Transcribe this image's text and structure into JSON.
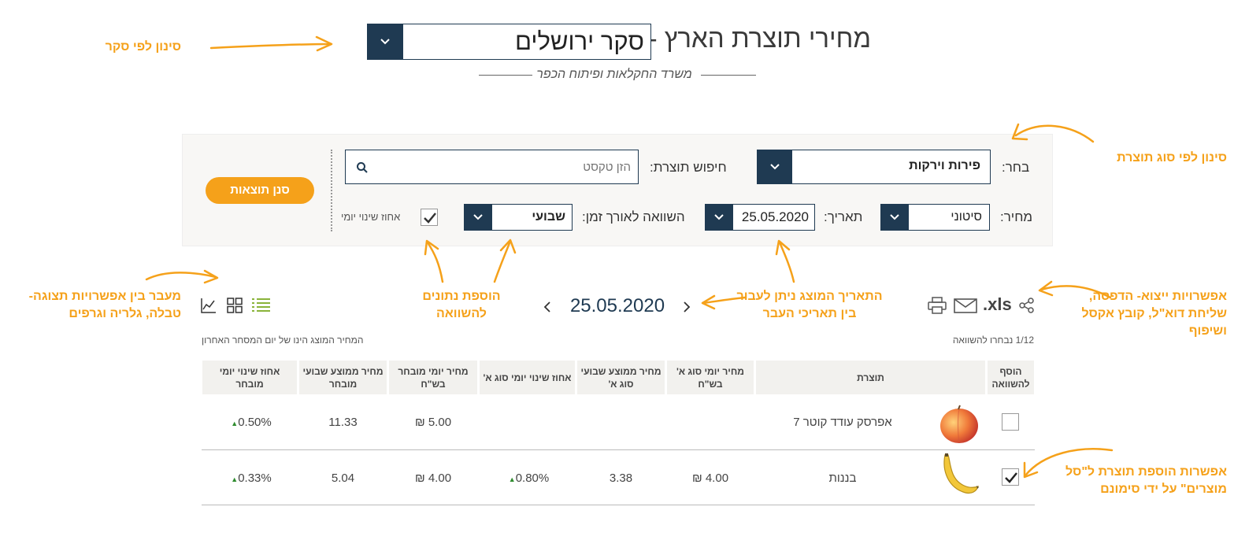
{
  "header": {
    "title": "מחירי תוצרת הארץ -",
    "survey_selected": "סקר ירושלים",
    "subtitle": "משרד החקלאות ופיתוח הכפר"
  },
  "filters": {
    "choose_label": "בחר:",
    "choose_value": "פירות וירקות",
    "search_label": "חיפוש תוצרת:",
    "search_placeholder": "הזן טקסט",
    "price_label": "מחיר:",
    "price_value": "סיטוני",
    "date_label": "תאריך:",
    "date_value": "25.05.2020",
    "compare_label": "השוואה לאורך זמן:",
    "compare_value": "שבועי",
    "daily_pct_label": "אחוז שינוי יומי",
    "daily_pct_checked": true,
    "filter_button": "סנן תוצאות"
  },
  "toolbar": {
    "xls_label": ".xls",
    "current_date": "25.05.2020",
    "selected_count": "1/12 נבחרו להשוואה",
    "price_note": "המחיר המוצג הינו של יום המסחר האחרון"
  },
  "table": {
    "headers": {
      "add": "הוסף להשוואה",
      "product": "תוצרת",
      "daily_a": "מחיר יומי סוג א' בש\"ח",
      "weekly_avg_a": "מחיר ממוצע שבועי סוג א'",
      "daily_pct_a": "אחוז שינוי יומי סוג א'",
      "daily_sel": "מחיר יומי מובחר בש\"ח",
      "weekly_avg_sel": "מחיר ממוצע שבועי מובחר",
      "daily_pct_sel": "אחוז שינוי יומי מובחר"
    },
    "rows": [
      {
        "checked": false,
        "image": "peach",
        "product": "אפרסק עודד קוטר 7",
        "daily_a": "",
        "weekly_avg_a": "",
        "daily_pct_a": "",
        "daily_sel": "5.00 ₪",
        "weekly_avg_sel": "11.33",
        "daily_pct_sel": "0.50%"
      },
      {
        "checked": true,
        "image": "banana",
        "product": "בננות",
        "daily_a": "4.00 ₪",
        "weekly_avg_a": "3.38",
        "daily_pct_a": "0.80%",
        "daily_sel": "4.00 ₪",
        "weekly_avg_sel": "5.04",
        "daily_pct_sel": "0.33%"
      }
    ]
  },
  "annotations": {
    "survey_filter": "סינון לפי סקר",
    "product_type_filter": "סינון לפי סוג תוצרת",
    "view_switch": "מעבר בין אפשרויות תצוגה- טבלה, גלריה וגרפים",
    "add_compare": "הוספת נתונים להשוואה",
    "date_nav": "התאריך המוצג ניתן לעבור בין תאריכי העבר",
    "export": "אפשרויות ייצוא- הדפסה, שליחת דוא\"ל, קובץ אקסל ושיפוף",
    "basket": "אפשרות הוספת תוצרת ל\"סל מוצרים\" על ידי סימונם"
  },
  "colors": {
    "navy": "#1f3a52",
    "accent_orange": "#f5a11a",
    "positive_green": "#2e8b2e",
    "panel_bg": "#f8f7f5"
  }
}
